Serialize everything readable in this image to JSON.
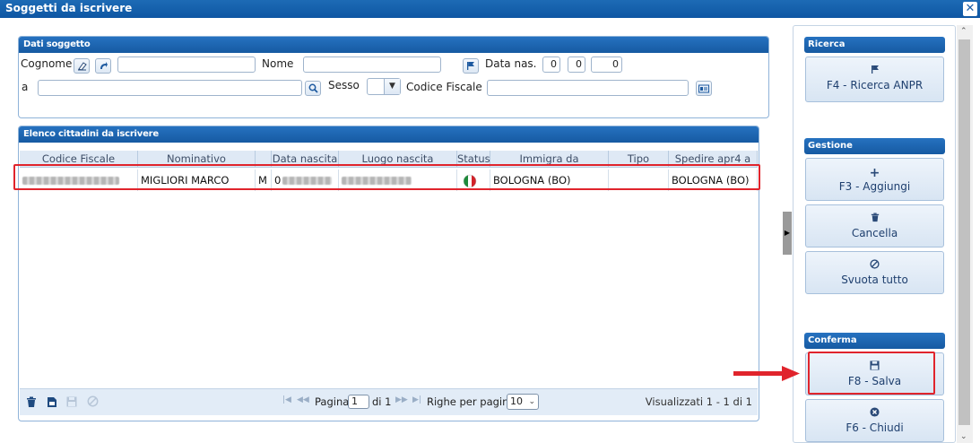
{
  "window": {
    "title": "Soggetti da iscrivere",
    "close_glyph": "✕"
  },
  "dati_soggetto": {
    "title": "Dati soggetto",
    "cognome_label": "Cognome",
    "nome_label": "Nome",
    "data_nas_label": "Data nas.",
    "data_day": "0",
    "data_month": "0",
    "data_year": "0",
    "a_label": "a",
    "sesso_label": "Sesso",
    "codice_fiscale_label": "Codice Fiscale"
  },
  "elenco": {
    "title": "Elenco cittadini da iscrivere",
    "columns": [
      "Codice Fiscale",
      "Nominativo",
      "",
      "Data nascita",
      "Luogo nascita",
      "Status",
      "Immigra da",
      "Tipo",
      "Spedire apr4 a"
    ],
    "rows": [
      {
        "nominativo": "MIGLIORI MARCO",
        "sesso": "M",
        "data_prefix": "0",
        "immigra_da": "BOLOGNA (BO)",
        "tipo": "",
        "spedire": "BOLOGNA (BO)",
        "status_flag": "italy-flag-icon"
      }
    ],
    "footer": {
      "pagina_label": "Pagina",
      "page_value": "1",
      "di_label": "di 1",
      "righe_label": "Righe per pagina:",
      "righe_value": "10",
      "visualizzati": "Visualizzati 1 - 1 di 1"
    }
  },
  "sidebar": {
    "ricerca_title": "Ricerca",
    "ricerca_anpr": "F4 - Ricerca ANPR",
    "gestione_title": "Gestione",
    "aggiungi": "F3 - Aggiungi",
    "cancella": "Cancella",
    "svuota": "Svuota tutto",
    "conferma_title": "Conferma",
    "salva": "F8 - Salva",
    "chiudi": "F6 - Chiudi"
  },
  "colors": {
    "accent": "#1a64b0",
    "highlight": "#e0242c"
  }
}
